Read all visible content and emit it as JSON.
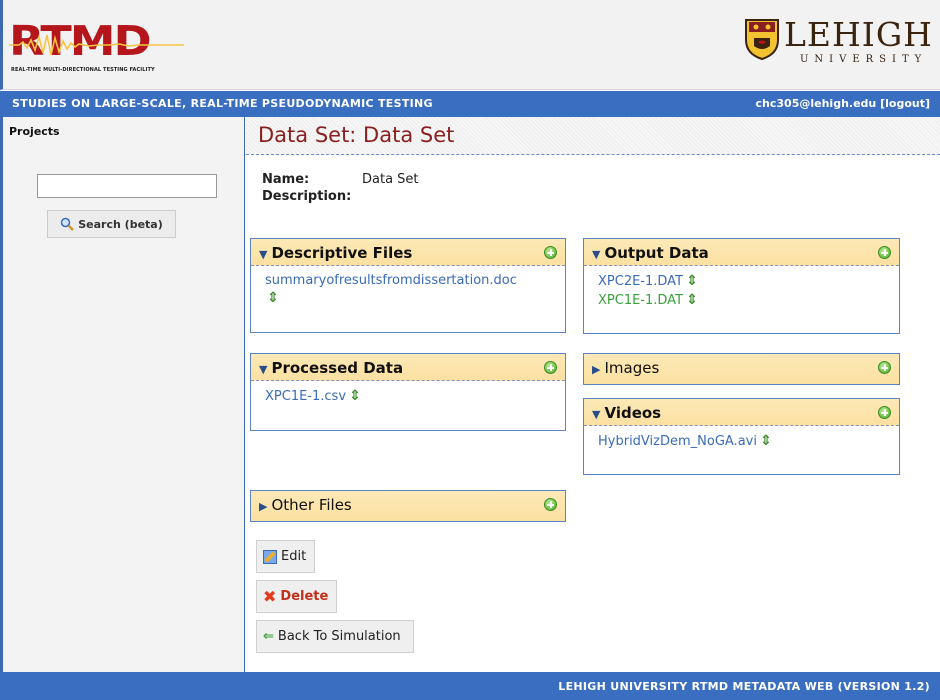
{
  "header": {
    "logo_text": "RTMD",
    "logo_subtitle": "REAL-TIME MULTI-DIRECTIONAL TESTING FACILITY",
    "university_name": "LEHIGH",
    "university_sub": "UNIVERSITY"
  },
  "nav": {
    "title": "STUDIES ON LARGE-SCALE, REAL-TIME PSEUDODYNAMIC TESTING",
    "user_email": "chc305@lehigh.edu",
    "logout": "[logout]"
  },
  "sidebar": {
    "heading": "Projects",
    "search_value": "",
    "search_button": "Search (beta)"
  },
  "main": {
    "title": "Data Set: Data Set",
    "name_label": "Name:",
    "name_value": "Data Set",
    "description_label": "Description:",
    "description_value": ""
  },
  "panels": {
    "descriptive_files": {
      "title": "Descriptive Files",
      "expanded": true,
      "files": [
        "summaryofresultsfromdissertation.doc"
      ]
    },
    "output_data": {
      "title": "Output Data",
      "expanded": true,
      "files": [
        "XPC2E-1.DAT",
        "XPC1E-1.DAT"
      ]
    },
    "processed_data": {
      "title": "Processed Data",
      "expanded": true,
      "files": [
        "XPC1E-1.csv"
      ]
    },
    "images": {
      "title": "Images",
      "expanded": false
    },
    "videos": {
      "title": "Videos",
      "expanded": true,
      "files": [
        "HybridVizDem_NoGA.avi"
      ]
    },
    "other_files": {
      "title": "Other Files",
      "expanded": false
    }
  },
  "actions": {
    "edit": "Edit",
    "delete": "Delete",
    "back": "Back To Simulation"
  },
  "footer": {
    "text": "LEHIGH UNIVERSITY RTMD METADATA WEB (VERSION 1.2)"
  },
  "colors": {
    "nav_blue": "#3a6ec0",
    "title_red": "#8a1f1f",
    "panel_header": "#fbe0a0",
    "link_blue": "#3a6bb8",
    "link_green": "#3aa03a"
  }
}
